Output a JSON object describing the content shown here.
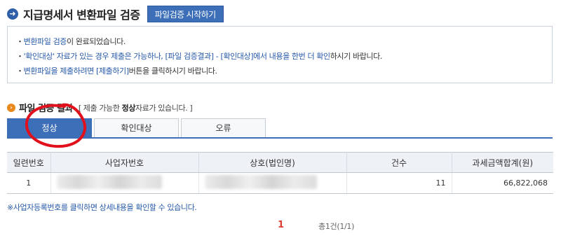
{
  "header": {
    "icon": "arrow-right-circle-icon",
    "title": "지급명세서 변환파일 검증",
    "start_button_label": "파일검증 시작하기"
  },
  "notice": {
    "line1_hl": "변환파일 검증",
    "line1_rest": "이 완료되었습니다.",
    "line2_hl": "'확인대상' 자료가 있는 경우 제출은 가능하나, [파일 검증결과] - [확인대상]에서 내용을 한번 더 확인",
    "line2_rest": "하시기 바랍니다.",
    "line3_hl": "변환파일을 제출하려면 [제출하기]",
    "line3_rest": "버튼을 클릭하시기 바랍니다."
  },
  "section": {
    "icon": "orange-circle-arrow-icon",
    "title": "파일 검증 결과",
    "note_open": "[ 제출 가능한 ",
    "note_bold": "정상",
    "note_close": "자료가 있습니다. ]"
  },
  "tabs": [
    {
      "label": "정상",
      "active": true
    },
    {
      "label": "확인대상",
      "active": false
    },
    {
      "label": "오류",
      "active": false
    }
  ],
  "table": {
    "headers": [
      "일련번호",
      "사업자번호",
      "상호(법인명)",
      "건수",
      "과세금액합계(원)"
    ],
    "rows": [
      {
        "serial": "1",
        "biz_no": "",
        "name": "",
        "count": "11",
        "amount": "66,822,068"
      }
    ]
  },
  "footnote": "※사업자등록번호를 클릭하면 상세내용을 확인할 수 있습니다.",
  "pagination": {
    "current_page": "1",
    "total": "총1건(1/1)"
  },
  "colors": {
    "accent": "#3c6fb8",
    "highlight_text": "#2659a8",
    "annotation_red": "#e0101c"
  }
}
